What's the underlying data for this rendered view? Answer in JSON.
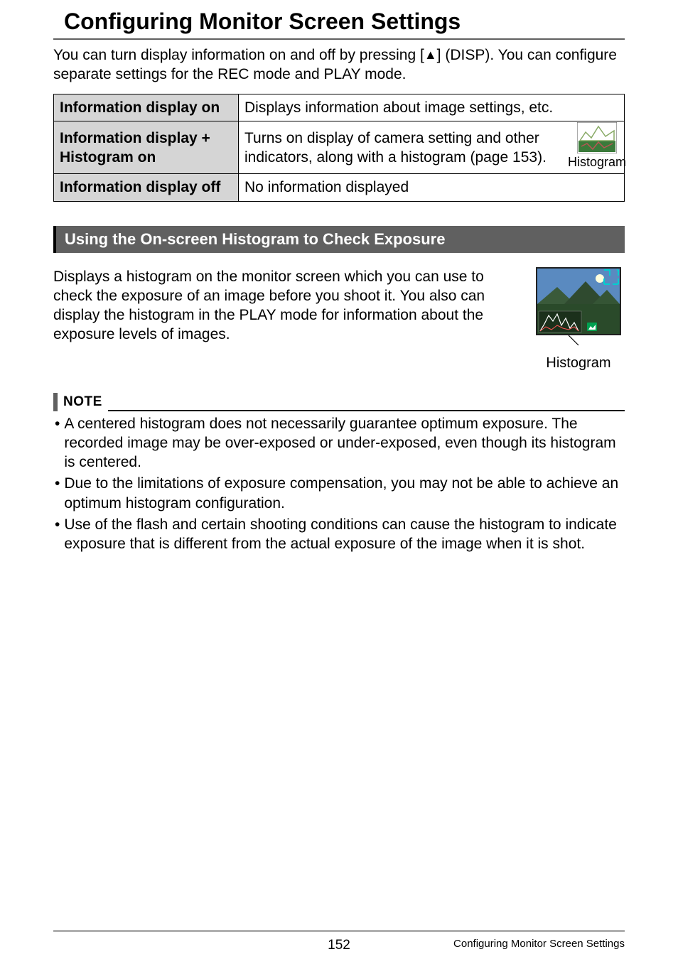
{
  "page_title": "Configuring Monitor Screen Settings",
  "intro_parts": {
    "a": "You can turn display information on and off by pressing [",
    "b": "] (DISP). You can configure separate settings for the REC mode and PLAY mode."
  },
  "table": {
    "rows": [
      {
        "label": "Information display on",
        "desc": "Displays information about image settings, etc."
      },
      {
        "label": "Information display + Histogram on",
        "desc": "Turns on display of camera setting and other indicators, along with a histogram (page 153).",
        "thumb_label": "Histogram"
      },
      {
        "label": "Information display off",
        "desc": "No information displayed"
      }
    ]
  },
  "subsection_title": "Using the On-screen Histogram to Check Exposure",
  "histogram_para": "Displays a histogram on the monitor screen which you can use to check the exposure of an image before you shoot it. You also can display the histogram in the PLAY mode for information about the exposure levels of images.",
  "histogram_caption": "Histogram",
  "note_label": "NOTE",
  "notes": [
    "A centered histogram does not necessarily guarantee optimum exposure. The recorded image may be over-exposed or under-exposed, even though its histogram is centered.",
    "Due to the limitations of exposure compensation, you may not be able to achieve an optimum histogram configuration.",
    "Use of the flash and certain shooting conditions can cause the histogram to indicate exposure that is different from the actual exposure of the image when it is shot."
  ],
  "footer": {
    "page_number": "152",
    "title": "Configuring Monitor Screen Settings"
  }
}
